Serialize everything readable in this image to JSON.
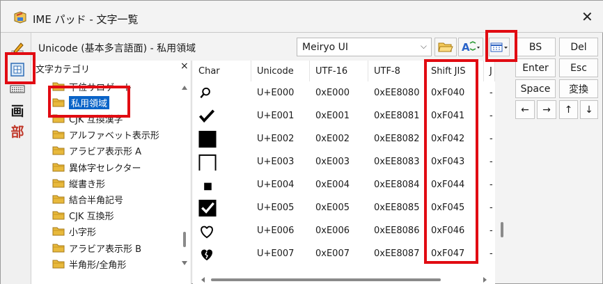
{
  "window": {
    "title": "IME パッド - 文字一覧",
    "close_glyph": "✕"
  },
  "left_toolbar": {
    "kanji_buttons": [
      "画",
      "部"
    ]
  },
  "header": {
    "category_title": "Unicode (基本多言語面) - 私用領域",
    "font_name": "Meiryo UI",
    "dropdown_glyph": "⌵"
  },
  "tree": {
    "title": "文字カテゴリ",
    "close_glyph": "×",
    "items": [
      {
        "label": "下位サロゲート",
        "selected": false
      },
      {
        "label": "私用領域",
        "selected": true
      },
      {
        "label": "CJK 互換漢字",
        "selected": false
      },
      {
        "label": "アルファベット表示形",
        "selected": false
      },
      {
        "label": "アラビア表示形 A",
        "selected": false
      },
      {
        "label": "異体字セレクター",
        "selected": false
      },
      {
        "label": "縦書き形",
        "selected": false
      },
      {
        "label": "結合半角記号",
        "selected": false
      },
      {
        "label": "CJK 互換形",
        "selected": false
      },
      {
        "label": "小字形",
        "selected": false
      },
      {
        "label": "アラビア表示形 B",
        "selected": false
      },
      {
        "label": "半角形/全角形",
        "selected": false
      }
    ]
  },
  "grid": {
    "columns": [
      "Char",
      "Unicode",
      "UTF-16",
      "UTF-8",
      "Shift JIS",
      "J"
    ],
    "rows": [
      {
        "glyph": "magnifier-icon",
        "unicode": "U+E000",
        "utf16": "0xE000",
        "utf8": "0xEE8080",
        "sjis": "0xF040",
        "j": "-"
      },
      {
        "glyph": "checkmark-icon",
        "unicode": "U+E001",
        "utf16": "0xE001",
        "utf8": "0xEE8081",
        "sjis": "0xF041",
        "j": "-"
      },
      {
        "glyph": "black-square-icon",
        "unicode": "U+E002",
        "utf16": "0xE002",
        "utf8": "0xEE8082",
        "sjis": "0xF042",
        "j": "-"
      },
      {
        "glyph": "open-square-icon",
        "unicode": "U+E003",
        "utf16": "0xE003",
        "utf8": "0xEE8083",
        "sjis": "0xF043",
        "j": "-"
      },
      {
        "glyph": "small-square-icon",
        "unicode": "U+E004",
        "utf16": "0xE004",
        "utf8": "0xEE8084",
        "sjis": "0xF044",
        "j": "-"
      },
      {
        "glyph": "checked-box-icon",
        "unicode": "U+E005",
        "utf16": "0xE005",
        "utf8": "0xEE8085",
        "sjis": "0xF045",
        "j": "-"
      },
      {
        "glyph": "heart-outline-icon",
        "unicode": "U+E006",
        "utf16": "0xE006",
        "utf8": "0xEE8086",
        "sjis": "0xF046",
        "j": "-"
      },
      {
        "glyph": "broken-heart-icon",
        "unicode": "U+E007",
        "utf16": "0xE007",
        "utf8": "0xEE8087",
        "sjis": "0xF047",
        "j": "-"
      }
    ]
  },
  "keys": {
    "bs": "BS",
    "del": "Del",
    "enter": "Enter",
    "esc": "Esc",
    "space": "Space",
    "convert": "変換",
    "left": "←",
    "right": "→",
    "up": "↑",
    "down": "↓"
  },
  "colors": {
    "highlight": "#e10b12",
    "selection": "#0a64c8",
    "folder": "#e8b93c"
  }
}
